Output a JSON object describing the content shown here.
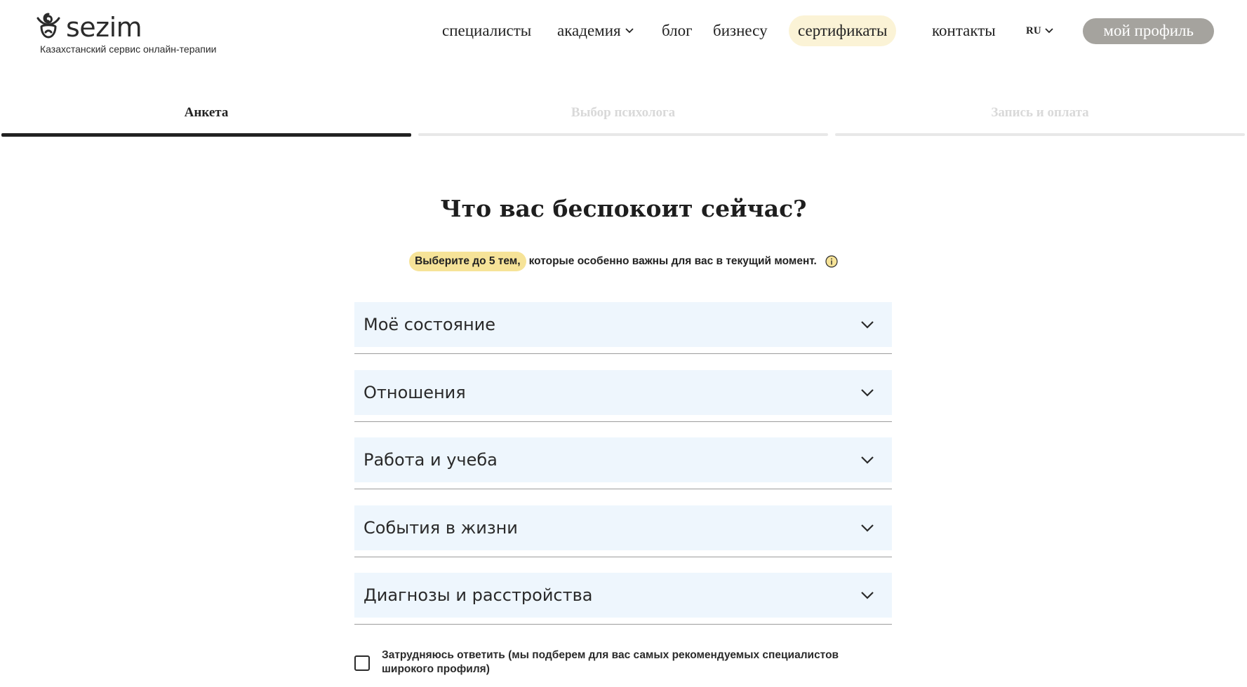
{
  "header": {
    "logo_text": "sezim",
    "tagline": "Казахстанский сервис онлайн-терапии",
    "nav": {
      "specialists": "специалисты",
      "academy": "академия",
      "blog": "блог",
      "business": "бизнесу",
      "certificates": "сертификаты",
      "contacts": "контакты",
      "language": "RU"
    },
    "profile_button": "мой профиль"
  },
  "steps": [
    {
      "label": "Анкета",
      "state": "active"
    },
    {
      "label": "Выбор психолога",
      "state": "inactive"
    },
    {
      "label": "Запись и оплата",
      "state": "inactive"
    }
  ],
  "main": {
    "title": "Что вас беспокоит сейчас?",
    "hint_highlight": "Выберите до 5 тем,",
    "hint_rest": "которые особенно важны для вас в текущий момент.",
    "info_icon": "info-icon",
    "categories": [
      "Моё состояние",
      "Отношения",
      "Работа и учеба",
      "События в жизни",
      "Диагнозы и расстройства"
    ],
    "unsure_label": "Затрудняюсь ответить (мы подберем для вас самых рекомендуемых специалистов широкого профиля)",
    "unsure_checked": false
  },
  "colors": {
    "certificates_bg": "#fbf3d6",
    "profile_button_bg": "#a5a39e",
    "hint_highlight_bg": "#f6e398",
    "accordion_bg": "#eef6fd",
    "active_step": "#222222",
    "inactive_step": "#e8e8e8"
  }
}
